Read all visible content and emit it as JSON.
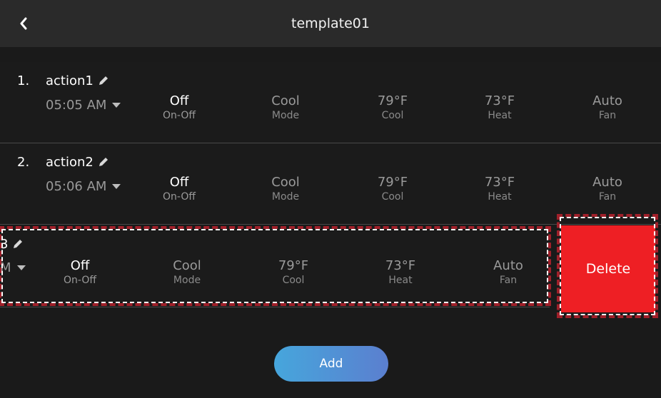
{
  "header": {
    "title": "template01",
    "back_icon": "chevron-left-icon"
  },
  "rows": [
    {
      "index": "1.",
      "name": "action1",
      "time": "05:05 AM",
      "params": [
        {
          "value": "Off",
          "label": "On-Off"
        },
        {
          "value": "Cool",
          "label": "Mode"
        },
        {
          "value": "79°F",
          "label": "Cool"
        },
        {
          "value": "73°F",
          "label": "Heat"
        },
        {
          "value": "Auto",
          "label": "Fan"
        }
      ]
    },
    {
      "index": "2.",
      "name": "action2",
      "time": "05:06 AM",
      "params": [
        {
          "value": "Off",
          "label": "On-Off"
        },
        {
          "value": "Cool",
          "label": "Mode"
        },
        {
          "value": "79°F",
          "label": "Cool"
        },
        {
          "value": "73°F",
          "label": "Heat"
        },
        {
          "value": "Auto",
          "label": "Fan"
        }
      ]
    },
    {
      "name_visible": "3",
      "time_visible": "M",
      "params": [
        {
          "value": "Off",
          "label": "On-Off"
        },
        {
          "value": "Cool",
          "label": "Mode"
        },
        {
          "value": "79°F",
          "label": "Cool"
        },
        {
          "value": "73°F",
          "label": "Heat"
        },
        {
          "value": "Auto",
          "label": "Fan"
        }
      ]
    }
  ],
  "delete_label": "Delete",
  "add_label": "Add",
  "colors": {
    "background": "#1a1a1a",
    "header": "#2a2a2a",
    "delete": "#ee1f24",
    "add_gradient_start": "#46a6dc",
    "add_gradient_end": "#5b7fcf",
    "highlight_dash": "#a0202a"
  }
}
